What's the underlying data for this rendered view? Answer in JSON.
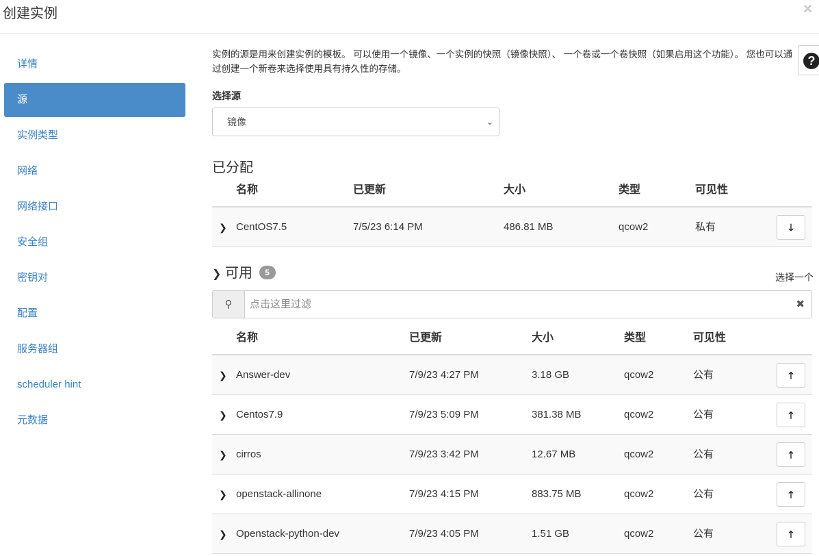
{
  "modal": {
    "title": "创建实例",
    "close_label": "×"
  },
  "sidebar": {
    "items": [
      {
        "label": "详情"
      },
      {
        "label": "源"
      },
      {
        "label": "实例类型"
      },
      {
        "label": "网络"
      },
      {
        "label": "网络接口"
      },
      {
        "label": "安全组"
      },
      {
        "label": "密钥对"
      },
      {
        "label": "配置"
      },
      {
        "label": "服务器组"
      },
      {
        "label": "scheduler hint"
      },
      {
        "label": "元数据"
      }
    ],
    "active_index": 1
  },
  "intro": {
    "text": "实例的源是用来创建实例的模板。 可以使用一个镜像、一个实例的快照（镜像快照）、 一个卷或一个卷快照（如果启用这个功能）。 您也可以通过创建一个新卷来选择使用具有持久性的存储。",
    "help_icon": "question-circle-icon"
  },
  "select_source": {
    "label": "选择源",
    "value": "镜像"
  },
  "allocated": {
    "title": "已分配",
    "columns": [
      "名称",
      "已更新",
      "大小",
      "类型",
      "可见性"
    ],
    "rows": [
      {
        "name": "CentOS7.5",
        "updated": "7/5/23 6:14 PM",
        "size": "486.81 MB",
        "type": "qcow2",
        "visibility": "私有",
        "action_icon": "arrow-down-icon"
      }
    ]
  },
  "available": {
    "title": "可用",
    "count": "5",
    "select_one": "选择一个",
    "filter_placeholder": "点击这里过滤",
    "columns": [
      "名称",
      "已更新",
      "大小",
      "类型",
      "可见性"
    ],
    "rows": [
      {
        "name": "Answer-dev",
        "updated": "7/9/23 4:27 PM",
        "size": "3.18 GB",
        "type": "qcow2",
        "visibility": "公有",
        "action_icon": "arrow-up-icon"
      },
      {
        "name": "Centos7.9",
        "updated": "7/9/23 5:09 PM",
        "size": "381.38 MB",
        "type": "qcow2",
        "visibility": "公有",
        "action_icon": "arrow-up-icon"
      },
      {
        "name": "cirros",
        "updated": "7/9/23 3:42 PM",
        "size": "12.67 MB",
        "type": "qcow2",
        "visibility": "公有",
        "action_icon": "arrow-up-icon"
      },
      {
        "name": "openstack-allinone",
        "updated": "7/9/23 4:15 PM",
        "size": "883.75 MB",
        "type": "qcow2",
        "visibility": "公有",
        "action_icon": "arrow-up-icon"
      },
      {
        "name": "Openstack-python-dev",
        "updated": "7/9/23 4:05 PM",
        "size": "1.51 GB",
        "type": "qcow2",
        "visibility": "公有",
        "action_icon": "arrow-up-icon"
      }
    ]
  },
  "colors": {
    "accent": "#4a8cc9",
    "link": "#3b82c4",
    "badge": "#999999"
  }
}
